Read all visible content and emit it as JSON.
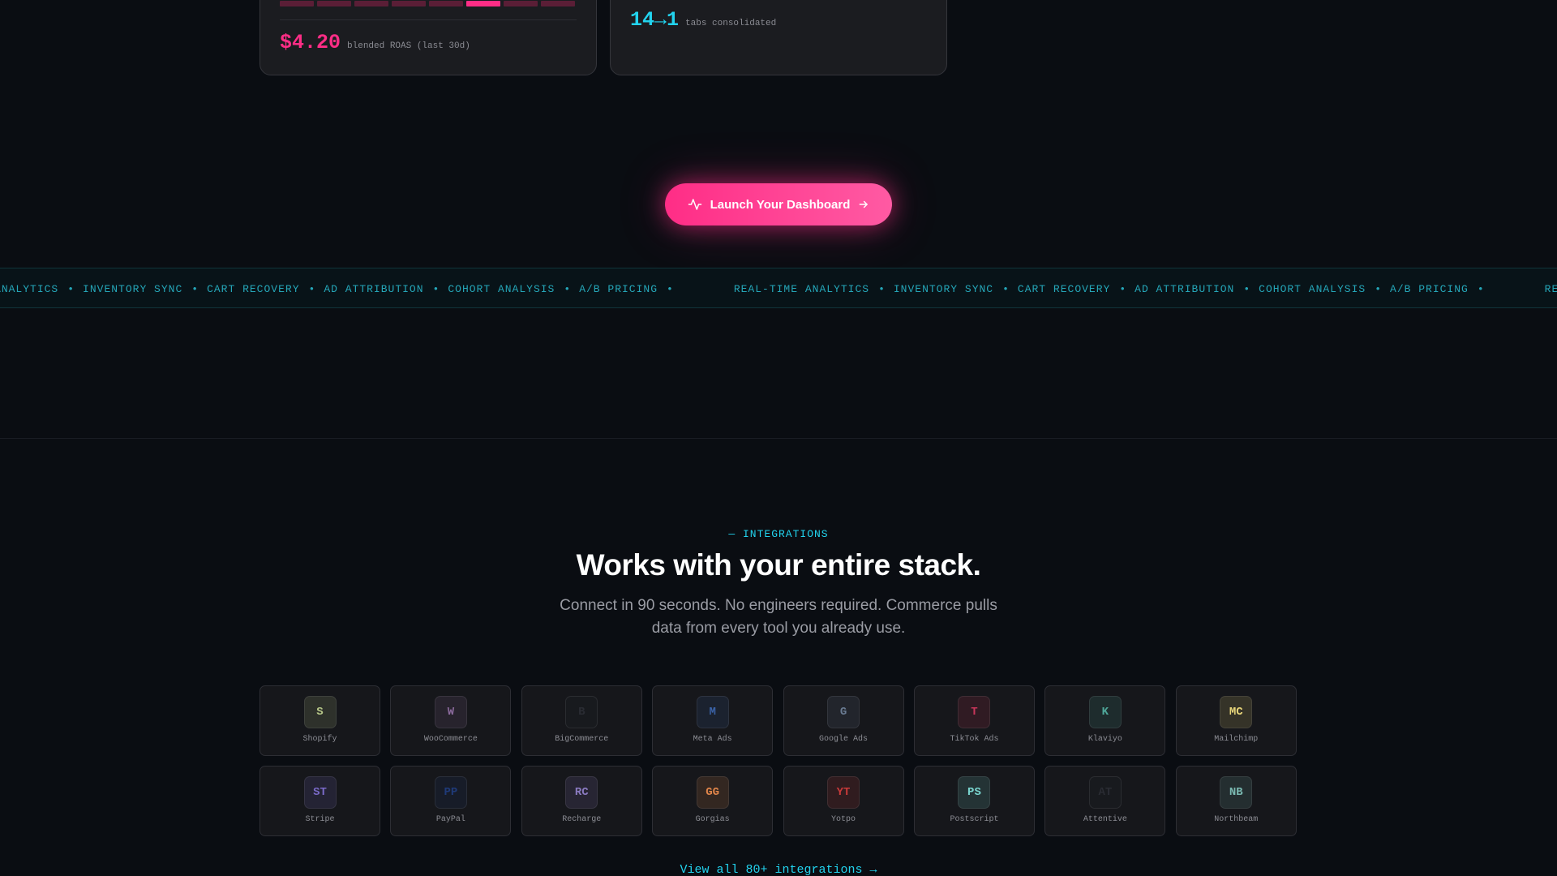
{
  "cards": {
    "left": {
      "bars_total": 8,
      "bars_active_index": 5,
      "bar_color": "#5a1e36",
      "bar_active_color": "#ff2d86",
      "stat_value": "$4.20",
      "stat_label": "blended ROAS (last 30d)"
    },
    "right": {
      "stat_value": "14→1",
      "stat_label": "tabs consolidated"
    }
  },
  "cta": {
    "label": "Launch Your Dashboard",
    "icon_left": "activity-pulse-icon",
    "icon_right": "arrow-right-icon"
  },
  "ticker": {
    "items": [
      "REAL-TIME ANALYTICS",
      "INVENTORY SYNC",
      "CART RECOVERY",
      "AD ATTRIBUTION",
      "COHORT ANALYSIS",
      "A/B PRICING"
    ],
    "separator": "•"
  },
  "integrations": {
    "eyebrow": "— INTEGRATIONS",
    "heading": "Works with your entire stack.",
    "subhead": "Connect in 90 seconds. No engineers required. Commerce pulls data from every tool you already use.",
    "tiles": [
      {
        "abbr": "S",
        "name": "Shopify",
        "color": "#b9c98a"
      },
      {
        "abbr": "W",
        "name": "WooCommerce",
        "color": "#8a6a9c"
      },
      {
        "abbr": "B",
        "name": "BigCommerce",
        "color": "#2a2c33"
      },
      {
        "abbr": "M",
        "name": "Meta Ads",
        "color": "#3b63a8"
      },
      {
        "abbr": "G",
        "name": "Google Ads",
        "color": "#6a7b92"
      },
      {
        "abbr": "T",
        "name": "TikTok Ads",
        "color": "#c8365a"
      },
      {
        "abbr": "K",
        "name": "Klaviyo",
        "color": "#4fa89a"
      },
      {
        "abbr": "MC",
        "name": "Mailchimp",
        "color": "#e8d67a"
      },
      {
        "abbr": "ST",
        "name": "Stripe",
        "color": "#7a6ac8"
      },
      {
        "abbr": "PP",
        "name": "PayPal",
        "color": "#1f3a78"
      },
      {
        "abbr": "RC",
        "name": "Recharge",
        "color": "#8a7ac0"
      },
      {
        "abbr": "GG",
        "name": "Gorgias",
        "color": "#e0854a"
      },
      {
        "abbr": "YT",
        "name": "Yotpo",
        "color": "#c83a3a"
      },
      {
        "abbr": "PS",
        "name": "Postscript",
        "color": "#7ad6d0"
      },
      {
        "abbr": "AT",
        "name": "Attentive",
        "color": "#2a2c33"
      },
      {
        "abbr": "NB",
        "name": "Northbeam",
        "color": "#7ab8b0"
      }
    ],
    "view_all": "View all 80+ integrations →"
  }
}
